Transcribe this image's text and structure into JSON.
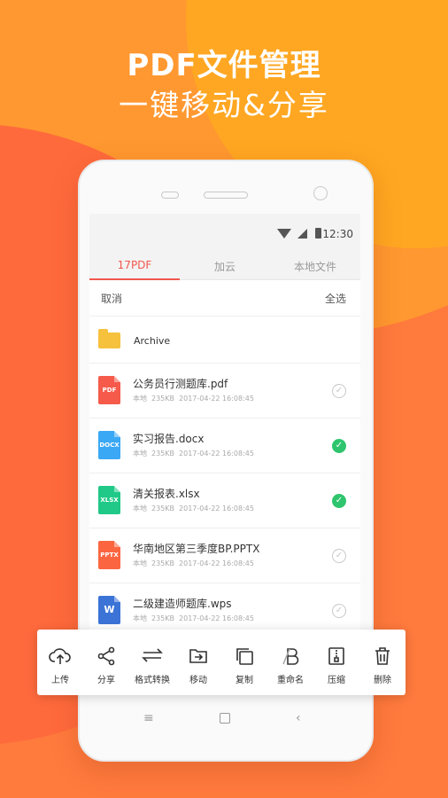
{
  "promo": {
    "title": "PDF文件管理",
    "subtitle": "一键移动&分享"
  },
  "status": {
    "time": "12:30"
  },
  "tabs": [
    {
      "label": "17PDF",
      "active": true
    },
    {
      "label": "加云",
      "active": false
    },
    {
      "label": "本地文件",
      "active": false
    }
  ],
  "actions": {
    "cancel": "取消",
    "select_all": "全选"
  },
  "folder": {
    "name": "Archive",
    "icon": "folder-icon"
  },
  "files": [
    {
      "name": "公务员行测题库.pdf",
      "type": "PDF",
      "color": "#f55a4a",
      "location": "本地",
      "size": "235KB",
      "date": "2017-04-22 16:08:45",
      "selected": false
    },
    {
      "name": "实习报告.docx",
      "type": "DOCX",
      "color": "#3aa8f5",
      "location": "本地",
      "size": "235KB",
      "date": "2017-04-22 16:08:45",
      "selected": true
    },
    {
      "name": "清关报表.xlsx",
      "type": "XLSX",
      "color": "#20c987",
      "location": "本地",
      "size": "235KB",
      "date": "2017-04-22 16:08:45",
      "selected": true
    },
    {
      "name": "华南地区第三季度BP.PPTX",
      "type": "PPTX",
      "color": "#fb6640",
      "location": "本地",
      "size": "235KB",
      "date": "2017-04-22 16:08:45",
      "selected": false
    },
    {
      "name": "二级建造师题库.wps",
      "type": "W",
      "color": "#3b73d6",
      "location": "本地",
      "size": "235KB",
      "date": "2017-04-22 16:08:45",
      "selected": false
    }
  ],
  "toolbar": [
    {
      "label": "上传",
      "icon": "upload-cloud-icon"
    },
    {
      "label": "分享",
      "icon": "share-icon"
    },
    {
      "label": "格式转换",
      "icon": "convert-icon"
    },
    {
      "label": "移动",
      "icon": "move-icon"
    },
    {
      "label": "复制",
      "icon": "copy-icon"
    },
    {
      "label": "重命名",
      "icon": "rename-icon"
    },
    {
      "label": "压缩",
      "icon": "compress-icon"
    },
    {
      "label": "删除",
      "icon": "trash-icon"
    }
  ],
  "colors": {
    "accent": "#f2574e",
    "check_on": "#2fc56e",
    "folder": "#f6c13d"
  }
}
